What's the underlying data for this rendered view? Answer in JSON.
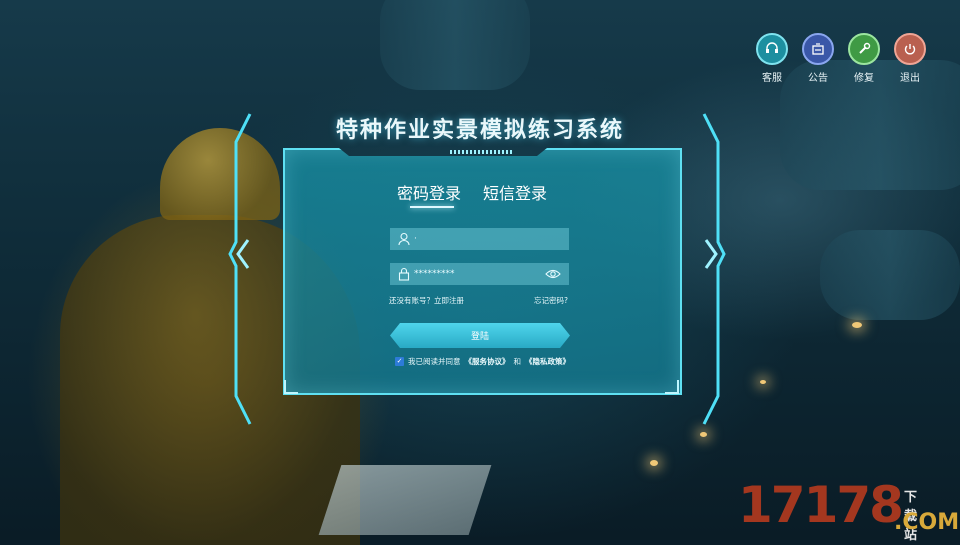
{
  "top_icons": [
    {
      "icon": "headset-icon",
      "label": "客服",
      "color": "#1d8fa0"
    },
    {
      "icon": "notice-icon",
      "label": "公告",
      "color": "#3a57a8"
    },
    {
      "icon": "wrench-icon",
      "label": "修复",
      "color": "#3f9a44"
    },
    {
      "icon": "power-icon",
      "label": "退出",
      "color": "#b9604f"
    }
  ],
  "title": "特种作业实景模拟练习系统",
  "tabs": [
    {
      "label": "密码登录",
      "active": true
    },
    {
      "label": "短信登录",
      "active": false
    }
  ],
  "form": {
    "username_value": "·",
    "password_value": "*********",
    "register_text": "还没有账号？立即注册",
    "forgot_text": "忘记密码?",
    "login_label": "登陆",
    "agree_prefix": "我已阅读并同意",
    "service_agreement": "《服务协议》",
    "and_text": "和",
    "privacy_policy": "《隐私政策》",
    "agree_checked": true
  },
  "watermark": {
    "number": "17178",
    "dot_com": ".COM",
    "download": "下载站"
  }
}
